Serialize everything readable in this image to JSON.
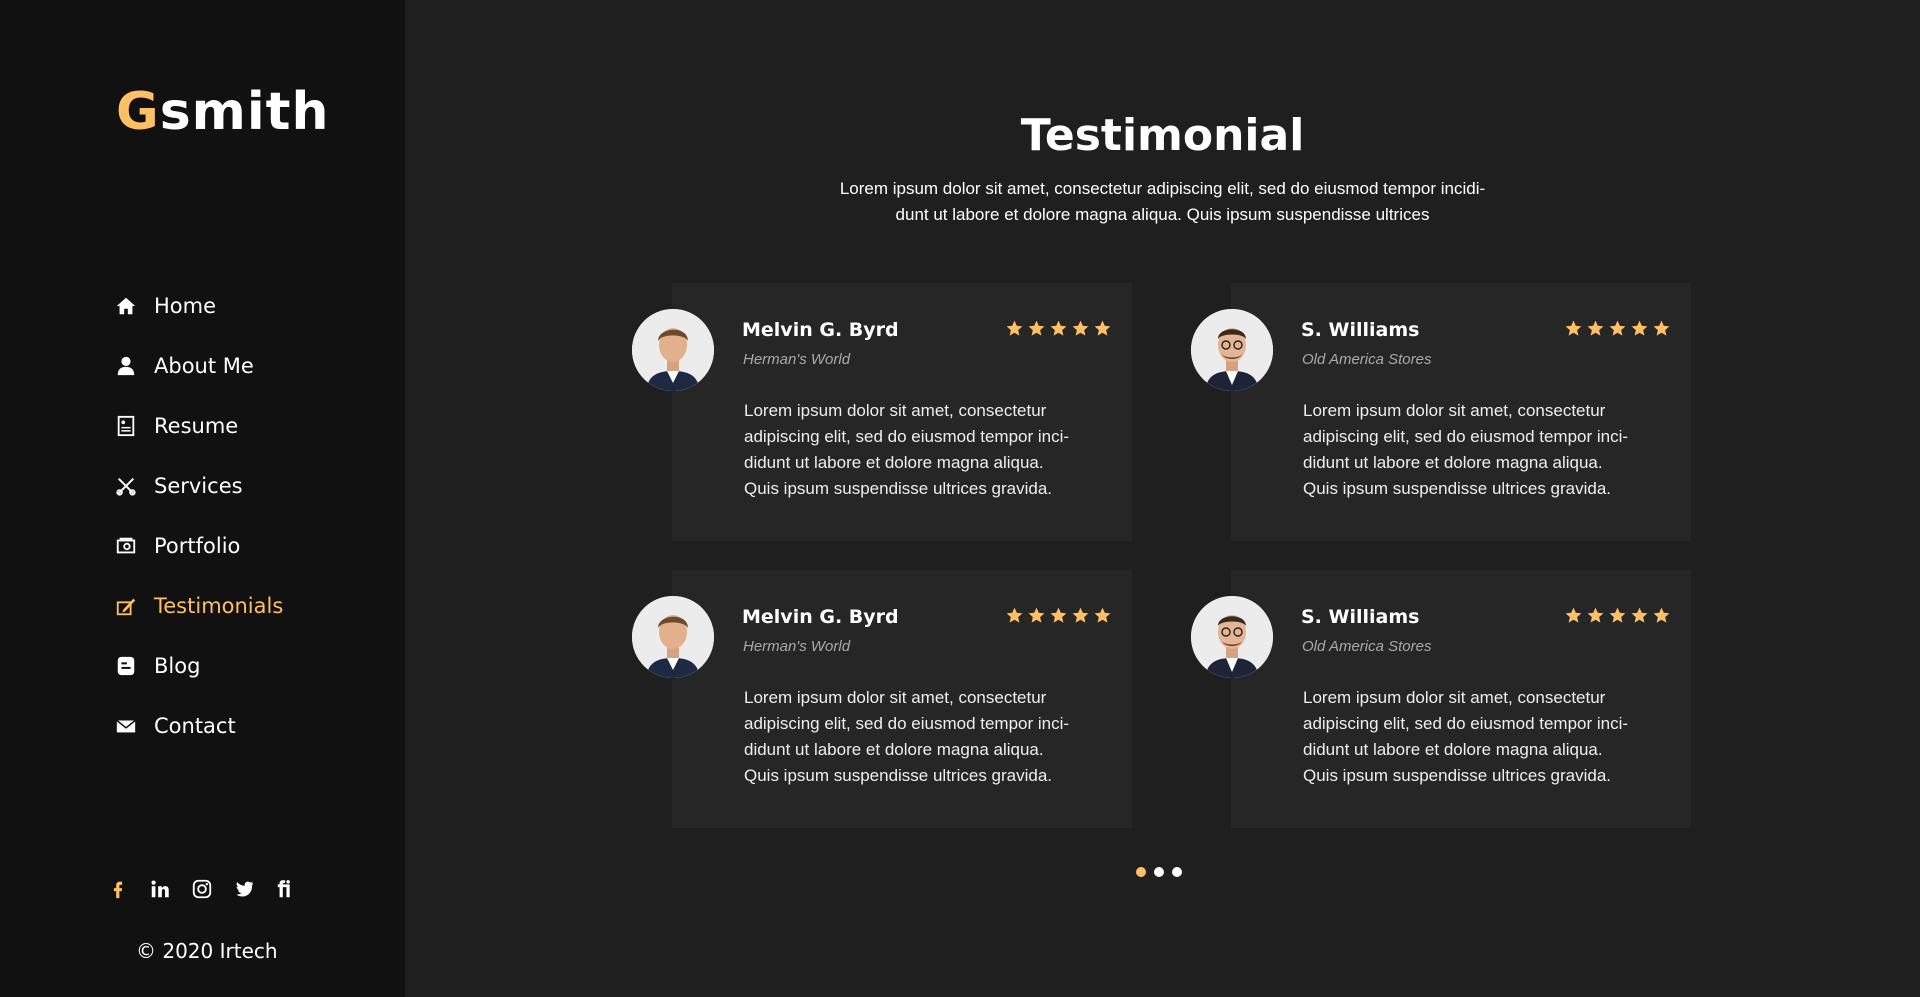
{
  "brand": {
    "first_letter": "G",
    "rest": "smith"
  },
  "nav": [
    {
      "label": "Home",
      "icon": "home-icon"
    },
    {
      "label": "About Me",
      "icon": "user-icon"
    },
    {
      "label": "Resume",
      "icon": "resume-icon"
    },
    {
      "label": "Services",
      "icon": "tools-icon"
    },
    {
      "label": "Portfolio",
      "icon": "portfolio-icon"
    },
    {
      "label": "Testimonials",
      "icon": "testimonial-icon",
      "active": true
    },
    {
      "label": "Blog",
      "icon": "blog-icon"
    },
    {
      "label": "Contact",
      "icon": "mail-icon"
    }
  ],
  "social": [
    "facebook-icon",
    "linkedin-icon",
    "instagram-icon",
    "twitter-icon",
    "fiverr-icon"
  ],
  "copyright": "© 2020 Irtech",
  "section": {
    "title": "Testimonial",
    "subtitle_line1": "Lorem ipsum dolor sit amet, consectetur adipiscing elit, sed do eiusmod tempor incidi-",
    "subtitle_line2": "dunt ut labore et dolore magna aliqua. Quis ipsum suspendisse ultrices"
  },
  "testimonials": [
    {
      "name": "Melvin G. Byrd",
      "company": "Herman's World",
      "rating": 5,
      "text": [
        "Lorem ipsum dolor sit amet, consectetur",
        "adipiscing elit, sed do eiusmod tempor inci-",
        "didunt ut labore et dolore magna aliqua.",
        "Quis ipsum suspendisse ultrices gravida."
      ]
    },
    {
      "name": "S. Williams",
      "company": "Old America Stores",
      "rating": 5,
      "text": [
        "Lorem ipsum dolor sit amet, consectetur",
        "adipiscing elit, sed do eiusmod tempor inci-",
        "didunt ut labore et dolore magna aliqua.",
        "Quis ipsum suspendisse ultrices gravida."
      ]
    },
    {
      "name": "Melvin G. Byrd",
      "company": "Herman's World",
      "rating": 5,
      "text": [
        "Lorem ipsum dolor sit amet, consectetur",
        "adipiscing elit, sed do eiusmod tempor inci-",
        "didunt ut labore et dolore magna aliqua.",
        "Quis ipsum suspendisse ultrices gravida."
      ]
    },
    {
      "name": "S. Williams",
      "company": "Old America Stores",
      "rating": 5,
      "text": [
        "Lorem ipsum dolor sit amet, consectetur",
        "adipiscing elit, sed do eiusmod tempor inci-",
        "didunt ut labore et dolore magna aliqua.",
        "Quis ipsum suspendisse ultrices gravida."
      ]
    }
  ],
  "pagination": {
    "count": 3,
    "active": 0
  },
  "colors": {
    "accent": "#ffbf66",
    "sidebar_bg": "#111111",
    "main_bg": "#1f1f1f",
    "card_bg": "#262626"
  }
}
